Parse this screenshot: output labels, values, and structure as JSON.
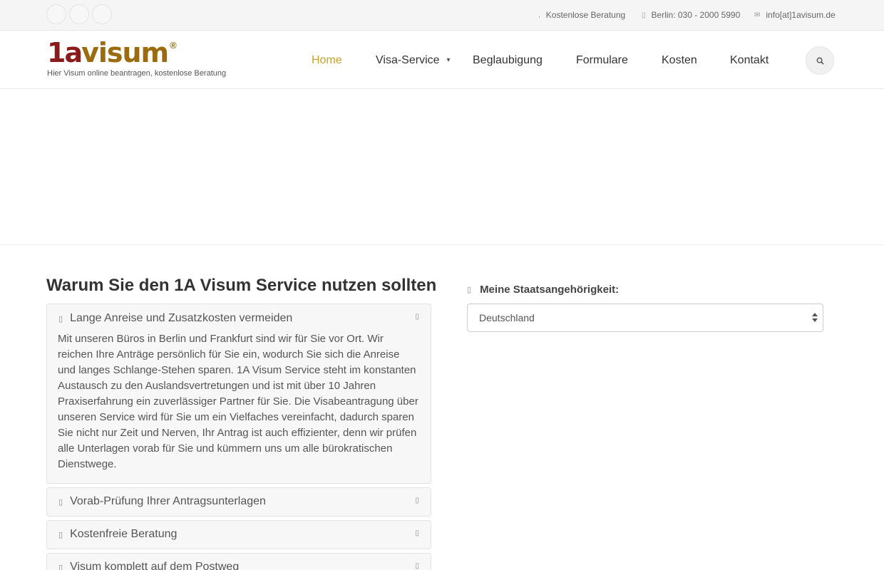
{
  "topbar": {
    "social_icons": [
      "facebook-icon",
      "twitter-icon",
      "google-plus-icon"
    ],
    "consult": {
      "icon": "comment-icon",
      "text": "Kostenlose Beratung"
    },
    "phone": {
      "icon": "phone-icon",
      "text": "Berlin: 030 - 2000 5990"
    },
    "email": {
      "icon": "envelope-icon",
      "text": "info[at]1avisum.de"
    }
  },
  "header": {
    "logo": {
      "num": "1a",
      "word": "visum",
      "reg": "®"
    },
    "tagline": "Hier Visum online beantragen, kostenlose Beratung",
    "nav": {
      "home": "Home",
      "visa": "Visa-Service",
      "beglaubigung": "Beglaubigung",
      "formulare": "Formulare",
      "kosten": "Kosten",
      "kontakt": "Kontakt"
    },
    "search_icon": "search-icon",
    "active_color": "#c9a227"
  },
  "main": {
    "title_pre": "Warum Sie den ",
    "title_bold": "1A Visum Service",
    "title_post": " nutzen sollten",
    "panels": [
      {
        "title": "Lange Anreise und Zusatzkosten vermeiden",
        "body": "Mit unseren Büros in Berlin und Frankfurt sind wir für Sie vor Ort. Wir reichen Ihre Anträge persönlich für Sie ein, wodurch Sie sich die Anreise und langes Schlange-Stehen sparen. 1A Visum Service steht im konstanten Austausch zu den Auslandsvertretungen und ist mit über 10 Jahren Praxiserfahrung ein zuverlässiger Partner für Sie. Die Visabeantragung über unseren Service wird für Sie um ein Vielfaches vereinfacht, dadurch sparen Sie nicht nur Zeit und Nerven, Ihr Antrag ist auch effizienter, denn wir prüfen alle Unterlagen vorab für Sie und kümmern uns um alle bürokratischen Dienstwege."
      },
      {
        "title": "Vorab-Prüfung Ihrer Antragsunterlagen"
      },
      {
        "title": "Kostenfreie Beratung"
      },
      {
        "title": "Visum komplett auf dem Postweg"
      }
    ]
  },
  "sidebar": {
    "nationality_label": "Meine Staatsangehörigkeit:",
    "nationality_value": "Deutschland"
  }
}
